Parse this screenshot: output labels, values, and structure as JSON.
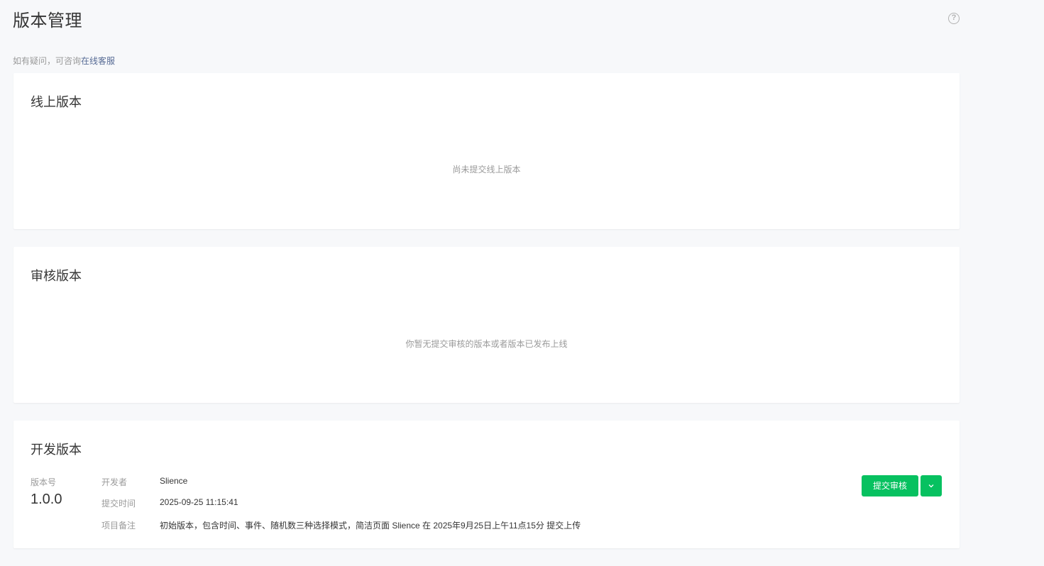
{
  "header": {
    "title": "版本管理",
    "help_icon": "question-circle-icon"
  },
  "hint": {
    "prefix": "如有疑问，可咨询",
    "link_text": "在线客服"
  },
  "online_version": {
    "title": "线上版本",
    "empty_text": "尚未提交线上版本"
  },
  "review_version": {
    "title": "审核版本",
    "empty_text": "你暂无提交审核的版本或者版本已发布上线"
  },
  "dev_version": {
    "title": "开发版本",
    "version_label": "版本号",
    "version_value": "1.0.0",
    "developer_label": "开发者",
    "developer_value": "Slience",
    "submit_time_label": "提交时间",
    "submit_time_value": "2025-09-25 11:15:41",
    "remark_label": "项目备注",
    "remark_value": "初始版本，包含时间、事件、随机数三种选择模式，简洁页面 Slience 在 2025年9月25日上午11点15分 提交上传",
    "submit_button": "提交审核",
    "more_icon": "chevron-down-icon"
  },
  "colors": {
    "primary": "#07c160",
    "link": "#576b95",
    "muted": "#9a9a9a"
  }
}
